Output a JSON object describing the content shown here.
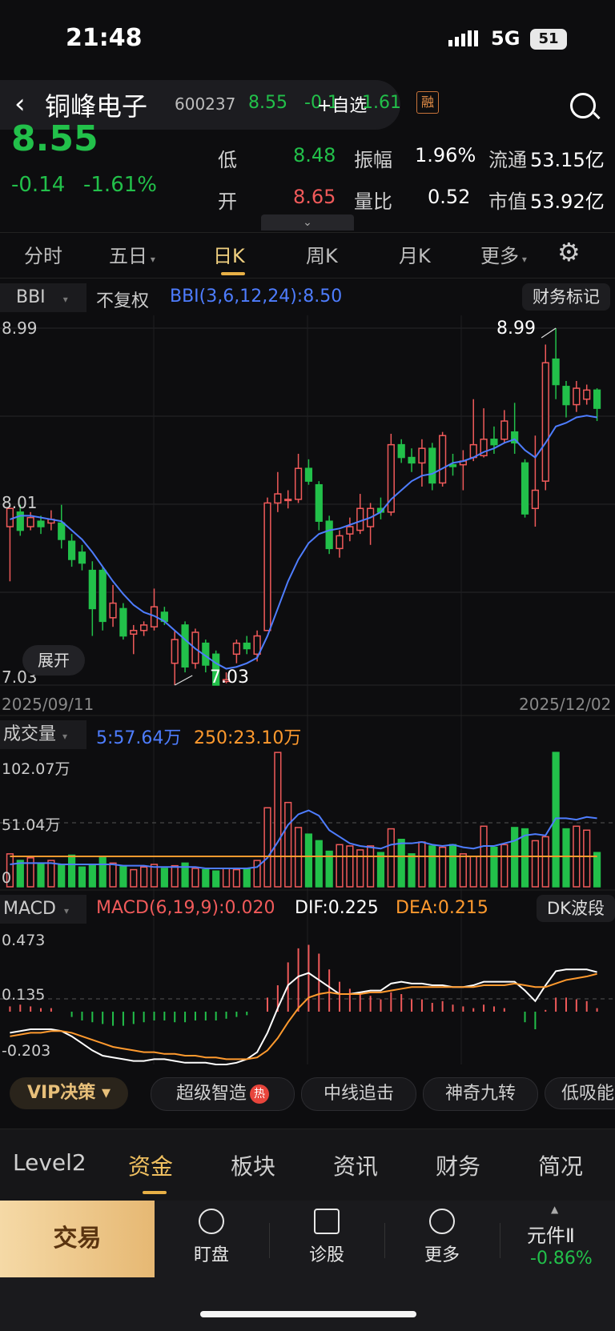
{
  "status": {
    "time": "21:48",
    "network": "5G",
    "battery": "51"
  },
  "header": {
    "back_icon": "chevron-left-icon",
    "stock_name": "铜峰电子",
    "stock_code": "600237",
    "price": "8.55",
    "change": "-0.1",
    "add_watch": "+自选",
    "change_pct": "1.61",
    "margin_badge": "融",
    "search_icon": "search-icon"
  },
  "quote": {
    "price": "8.55",
    "change": "-0.14",
    "change_pct": "-1.61%",
    "rows": [
      {
        "l1": "低",
        "v1": "8.48",
        "l2": "振幅",
        "v2": "1.96%",
        "l3": "流通",
        "v3": "53.15亿"
      },
      {
        "l1": "开",
        "v1": "8.65",
        "l2": "量比",
        "v2": "0.52",
        "l3": "市值",
        "v3": "53.92亿"
      }
    ]
  },
  "tabs": {
    "intraday": "分时",
    "five_day": "五日",
    "day_k": "日K",
    "week_k": "周K",
    "month_k": "月K",
    "more": "更多"
  },
  "kchart": {
    "indicator": "BBI",
    "adjust": "不复权",
    "bbi_label": "BBI(3,6,12,24):8.50",
    "finance_mark": "财务标记",
    "y_top": "8.99",
    "y_mid": "8.01",
    "y_bot": "7.03",
    "high_mark": "8.99",
    "low_mark": "7.03",
    "date_start": "2025/09/11",
    "date_end": "2025/12/02",
    "expand": "展开"
  },
  "volume": {
    "label": "成交量",
    "ma5": "5:57.64万",
    "ma250": "250:23.10万",
    "y_top": "102.07万",
    "y_mid": "51.04万",
    "y_bot": "0"
  },
  "macd": {
    "label": "MACD",
    "params": "MACD(6,19,9):0.020",
    "dif": "DIF:0.225",
    "dea": "DEA:0.215",
    "dk": "DK波段",
    "y_top": "0.473",
    "y_mid": "0.135",
    "y_bot": "-0.203"
  },
  "chips": {
    "vip": "VIP决策 ▾",
    "c1": "超级智造",
    "hot": "热",
    "c2": "中线追击",
    "c3": "神奇九转",
    "c4": "低吸能"
  },
  "bottom_tabs": [
    "Level2",
    "资金",
    "板块",
    "资讯",
    "财务",
    "简况"
  ],
  "bottom_bar": {
    "trade": "交易",
    "watch": "盯盘",
    "diagnose": "诊股",
    "more": "更多",
    "index_name": "元件Ⅱ",
    "index_chg": "-0.86%"
  },
  "chart_data": {
    "type": "candlestick",
    "title": "",
    "ylim": [
      7.03,
      8.99
    ],
    "x_range": [
      "2025/09/11",
      "2025/12/02"
    ],
    "candles": [
      {
        "o": 7.9,
        "c": 8.0,
        "h": 8.0,
        "l": 7.6
      },
      {
        "o": 7.98,
        "c": 7.88,
        "h": 8.02,
        "l": 7.85
      },
      {
        "o": 7.9,
        "c": 7.95,
        "h": 7.98,
        "l": 7.88
      },
      {
        "o": 7.93,
        "c": 7.9,
        "h": 7.96,
        "l": 7.86
      },
      {
        "o": 7.92,
        "c": 7.94,
        "h": 7.99,
        "l": 7.88
      },
      {
        "o": 7.92,
        "c": 7.83,
        "h": 8.02,
        "l": 7.78
      },
      {
        "o": 7.82,
        "c": 7.72,
        "h": 7.86,
        "l": 7.68
      },
      {
        "o": 7.76,
        "c": 7.7,
        "h": 7.8,
        "l": 7.66
      },
      {
        "o": 7.66,
        "c": 7.45,
        "h": 7.71,
        "l": 7.3
      },
      {
        "o": 7.66,
        "c": 7.38,
        "h": 7.68,
        "l": 7.33
      },
      {
        "o": 7.4,
        "c": 7.48,
        "h": 7.58,
        "l": 7.35
      },
      {
        "o": 7.45,
        "c": 7.3,
        "h": 7.48,
        "l": 7.28
      },
      {
        "o": 7.31,
        "c": 7.33,
        "h": 7.36,
        "l": 7.2
      },
      {
        "o": 7.33,
        "c": 7.36,
        "h": 7.38,
        "l": 7.3
      },
      {
        "o": 7.35,
        "c": 7.46,
        "h": 7.56,
        "l": 7.33
      },
      {
        "o": 7.43,
        "c": 7.38,
        "h": 7.46,
        "l": 7.36
      },
      {
        "o": 7.15,
        "c": 7.28,
        "h": 7.33,
        "l": 7.03
      },
      {
        "o": 7.36,
        "c": 7.13,
        "h": 7.38,
        "l": 7.1
      },
      {
        "o": 7.15,
        "c": 7.32,
        "h": 7.34,
        "l": 7.12
      },
      {
        "o": 7.26,
        "c": 7.14,
        "h": 7.28,
        "l": 7.1
      },
      {
        "o": 7.2,
        "c": 7.03,
        "h": 7.22,
        "l": 7.03
      },
      {
        "o": 7.05,
        "c": 7.06,
        "h": 7.1,
        "l": 7.04
      },
      {
        "o": 7.2,
        "c": 7.26,
        "h": 7.28,
        "l": 7.15
      },
      {
        "o": 7.26,
        "c": 7.23,
        "h": 7.3,
        "l": 7.2
      },
      {
        "o": 7.2,
        "c": 7.3,
        "h": 7.33,
        "l": 7.16
      },
      {
        "o": 7.33,
        "c": 8.03,
        "h": 8.06,
        "l": 7.33
      },
      {
        "o": 8.03,
        "c": 8.08,
        "h": 8.2,
        "l": 7.98
      },
      {
        "o": 8.05,
        "c": 8.05,
        "h": 8.1,
        "l": 8.0
      },
      {
        "o": 8.05,
        "c": 8.22,
        "h": 8.3,
        "l": 8.03
      },
      {
        "o": 8.22,
        "c": 8.15,
        "h": 8.27,
        "l": 8.13
      },
      {
        "o": 8.13,
        "c": 7.93,
        "h": 8.15,
        "l": 7.88
      },
      {
        "o": 7.93,
        "c": 7.78,
        "h": 7.96,
        "l": 7.75
      },
      {
        "o": 7.78,
        "c": 7.85,
        "h": 7.88,
        "l": 7.73
      },
      {
        "o": 7.86,
        "c": 7.9,
        "h": 7.95,
        "l": 7.82
      },
      {
        "o": 7.88,
        "c": 8.0,
        "h": 8.08,
        "l": 7.86
      },
      {
        "o": 7.9,
        "c": 8.0,
        "h": 8.03,
        "l": 7.8
      },
      {
        "o": 8.0,
        "c": 7.98,
        "h": 8.06,
        "l": 7.94
      },
      {
        "o": 7.98,
        "c": 8.35,
        "h": 8.41,
        "l": 7.96
      },
      {
        "o": 8.35,
        "c": 8.28,
        "h": 8.38,
        "l": 8.25
      },
      {
        "o": 8.28,
        "c": 8.25,
        "h": 8.33,
        "l": 8.2
      },
      {
        "o": 8.25,
        "c": 8.33,
        "h": 8.38,
        "l": 8.12
      },
      {
        "o": 8.33,
        "c": 8.14,
        "h": 8.36,
        "l": 8.1
      },
      {
        "o": 8.14,
        "c": 8.4,
        "h": 8.42,
        "l": 8.12
      },
      {
        "o": 8.24,
        "c": 8.23,
        "h": 8.3,
        "l": 8.18
      },
      {
        "o": 8.24,
        "c": 8.26,
        "h": 8.32,
        "l": 8.1
      },
      {
        "o": 8.28,
        "c": 8.35,
        "h": 8.6,
        "l": 8.26
      },
      {
        "o": 8.29,
        "c": 8.38,
        "h": 8.55,
        "l": 8.28
      },
      {
        "o": 8.38,
        "c": 8.35,
        "h": 8.45,
        "l": 8.3
      },
      {
        "o": 8.38,
        "c": 8.48,
        "h": 8.54,
        "l": 8.36
      },
      {
        "o": 8.42,
        "c": 8.36,
        "h": 8.58,
        "l": 8.3
      },
      {
        "o": 8.25,
        "c": 7.97,
        "h": 8.27,
        "l": 7.95
      },
      {
        "o": 8.0,
        "c": 8.1,
        "h": 8.4,
        "l": 7.9
      },
      {
        "o": 8.15,
        "c": 8.8,
        "h": 8.9,
        "l": 8.1
      },
      {
        "o": 8.82,
        "c": 8.68,
        "h": 8.99,
        "l": 8.6
      },
      {
        "o": 8.67,
        "c": 8.57,
        "h": 8.7,
        "l": 8.5
      },
      {
        "o": 8.57,
        "c": 8.66,
        "h": 8.7,
        "l": 8.53
      },
      {
        "o": 8.6,
        "c": 8.65,
        "h": 8.68,
        "l": 8.57
      },
      {
        "o": 8.65,
        "c": 8.55,
        "h": 8.66,
        "l": 8.48
      }
    ],
    "bbi": [
      7.94,
      7.96,
      7.96,
      7.95,
      7.94,
      7.93,
      7.88,
      7.83,
      7.76,
      7.68,
      7.6,
      7.53,
      7.47,
      7.43,
      7.41,
      7.38,
      7.33,
      7.28,
      7.23,
      7.19,
      7.15,
      7.12,
      7.13,
      7.15,
      7.18,
      7.3,
      7.45,
      7.6,
      7.72,
      7.81,
      7.86,
      7.88,
      7.89,
      7.91,
      7.93,
      7.95,
      7.98,
      8.05,
      8.1,
      8.15,
      8.18,
      8.19,
      8.22,
      8.25,
      8.26,
      8.28,
      8.31,
      8.33,
      8.36,
      8.38,
      8.32,
      8.28,
      8.36,
      8.45,
      8.47,
      8.5,
      8.51,
      8.5
    ],
    "volume_ylim": [
      0,
      102.07
    ],
    "volume": [
      25,
      20,
      22,
      18,
      20,
      17,
      24,
      15,
      16,
      22,
      18,
      16,
      13,
      15,
      17,
      14,
      16,
      18,
      14,
      13,
      12,
      14,
      13,
      14,
      20,
      60,
      102,
      64,
      45,
      40,
      35,
      27,
      32,
      31,
      28,
      31,
      26,
      44,
      36,
      25,
      34,
      31,
      30,
      32,
      25,
      23,
      46,
      30,
      32,
      45,
      44,
      35,
      38,
      102,
      44,
      46,
      43,
      26
    ],
    "vol_ma5": [
      17,
      18,
      18,
      18,
      18,
      17,
      17,
      17,
      17,
      17,
      17,
      16,
      16,
      16,
      15,
      15,
      15,
      15,
      15,
      14,
      14,
      14,
      14,
      14,
      15,
      22,
      34,
      47,
      55,
      58,
      54,
      43,
      38,
      33,
      31,
      30,
      29,
      32,
      33,
      33,
      34,
      32,
      31,
      32,
      30,
      29,
      31,
      31,
      33,
      35,
      39,
      40,
      39,
      52,
      52,
      51,
      53,
      52
    ],
    "vol_ma250": [
      23.1,
      23.1,
      23.1,
      23.1,
      23.1,
      23.1,
      23.1,
      23.1,
      23.1,
      23.1,
      23.1,
      23.1,
      23.1,
      23.1,
      23.1,
      23.1,
      23.1,
      23.1,
      23.1,
      23.1,
      23.1,
      23.1,
      23.1,
      23.1,
      23.1,
      23.1,
      23.1,
      23.1,
      23.1,
      23.1,
      23.1,
      23.1,
      23.1,
      23.1,
      23.1,
      23.1,
      23.1,
      23.1,
      23.1,
      23.1,
      23.1,
      23.1,
      23.1,
      23.1,
      23.1,
      23.1,
      23.1,
      23.1,
      23.1,
      23.1,
      23.1,
      23.1,
      23.1,
      23.1,
      23.1,
      23.1,
      23.1,
      23.1
    ],
    "macd_ylim": [
      -0.3,
      0.473
    ],
    "macd_hist": [
      0.03,
      0.04,
      0.03,
      0.02,
      0.02,
      0.0,
      -0.03,
      -0.05,
      -0.06,
      -0.07,
      -0.08,
      -0.08,
      -0.07,
      -0.06,
      -0.05,
      -0.05,
      -0.06,
      -0.06,
      -0.05,
      -0.05,
      -0.05,
      -0.04,
      -0.03,
      -0.02,
      0.0,
      0.08,
      0.15,
      0.28,
      0.36,
      0.38,
      0.33,
      0.24,
      0.17,
      0.13,
      0.1,
      0.09,
      0.07,
      0.11,
      0.1,
      0.07,
      0.07,
      0.05,
      0.06,
      0.04,
      0.03,
      0.02,
      0.04,
      0.03,
      0.02,
      0.0,
      -0.06,
      -0.1,
      0.01,
      0.08,
      0.08,
      0.07,
      0.06,
      0.02
    ],
    "dif": [
      -0.12,
      -0.11,
      -0.1,
      -0.1,
      -0.1,
      -0.11,
      -0.14,
      -0.18,
      -0.22,
      -0.25,
      -0.26,
      -0.27,
      -0.28,
      -0.28,
      -0.27,
      -0.27,
      -0.28,
      -0.29,
      -0.29,
      -0.29,
      -0.3,
      -0.3,
      -0.29,
      -0.27,
      -0.23,
      -0.12,
      0.02,
      0.15,
      0.2,
      0.22,
      0.18,
      0.14,
      0.1,
      0.1,
      0.11,
      0.12,
      0.12,
      0.16,
      0.17,
      0.16,
      0.16,
      0.15,
      0.15,
      0.14,
      0.14,
      0.15,
      0.17,
      0.17,
      0.17,
      0.17,
      0.12,
      0.06,
      0.15,
      0.23,
      0.24,
      0.24,
      0.24,
      0.225
    ],
    "dea": [
      -0.14,
      -0.13,
      -0.12,
      -0.12,
      -0.11,
      -0.11,
      -0.12,
      -0.14,
      -0.16,
      -0.18,
      -0.2,
      -0.21,
      -0.22,
      -0.23,
      -0.23,
      -0.24,
      -0.24,
      -0.25,
      -0.25,
      -0.26,
      -0.26,
      -0.27,
      -0.27,
      -0.27,
      -0.26,
      -0.22,
      -0.15,
      -0.06,
      0.02,
      0.08,
      0.1,
      0.11,
      0.1,
      0.1,
      0.1,
      0.11,
      0.11,
      0.12,
      0.13,
      0.14,
      0.14,
      0.14,
      0.14,
      0.14,
      0.14,
      0.14,
      0.15,
      0.15,
      0.15,
      0.16,
      0.15,
      0.14,
      0.14,
      0.16,
      0.18,
      0.19,
      0.2,
      0.215
    ]
  },
  "colors": {
    "up": "#f05a5a",
    "down": "#22c04a",
    "bbi": "#4e7dff",
    "ma250": "#ff9a2e",
    "dif": "#ffffff",
    "accent": "#e8b046"
  }
}
